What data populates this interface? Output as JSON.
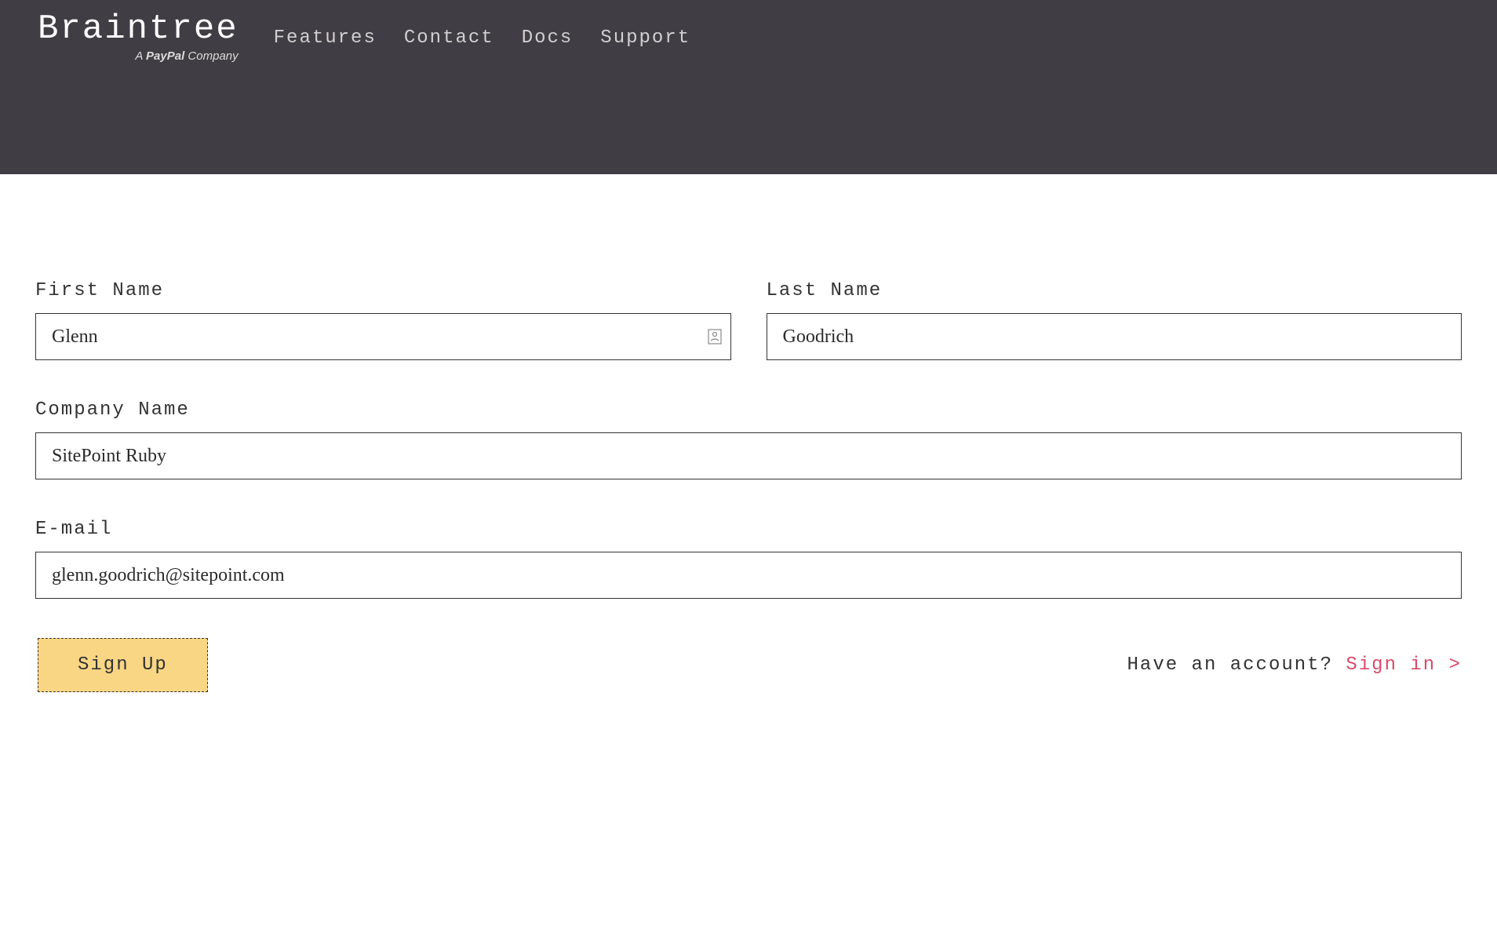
{
  "header": {
    "logo_main": "Braintree",
    "logo_sub_prefix": "A ",
    "logo_sub_brand": "PayPal",
    "logo_sub_suffix": " Company",
    "nav": {
      "features": "Features",
      "contact": "Contact",
      "docs": "Docs",
      "support": "Support"
    }
  },
  "form": {
    "first_name": {
      "label": "First Name",
      "value": "Glenn"
    },
    "last_name": {
      "label": "Last Name",
      "value": "Goodrich"
    },
    "company_name": {
      "label": "Company Name",
      "value": "SitePoint Ruby"
    },
    "email": {
      "label": "E-mail",
      "value": "glenn.goodrich@sitepoint.com"
    }
  },
  "footer": {
    "signup_button": "Sign Up",
    "have_account": "Have an account? ",
    "signin_link": "Sign in >"
  }
}
